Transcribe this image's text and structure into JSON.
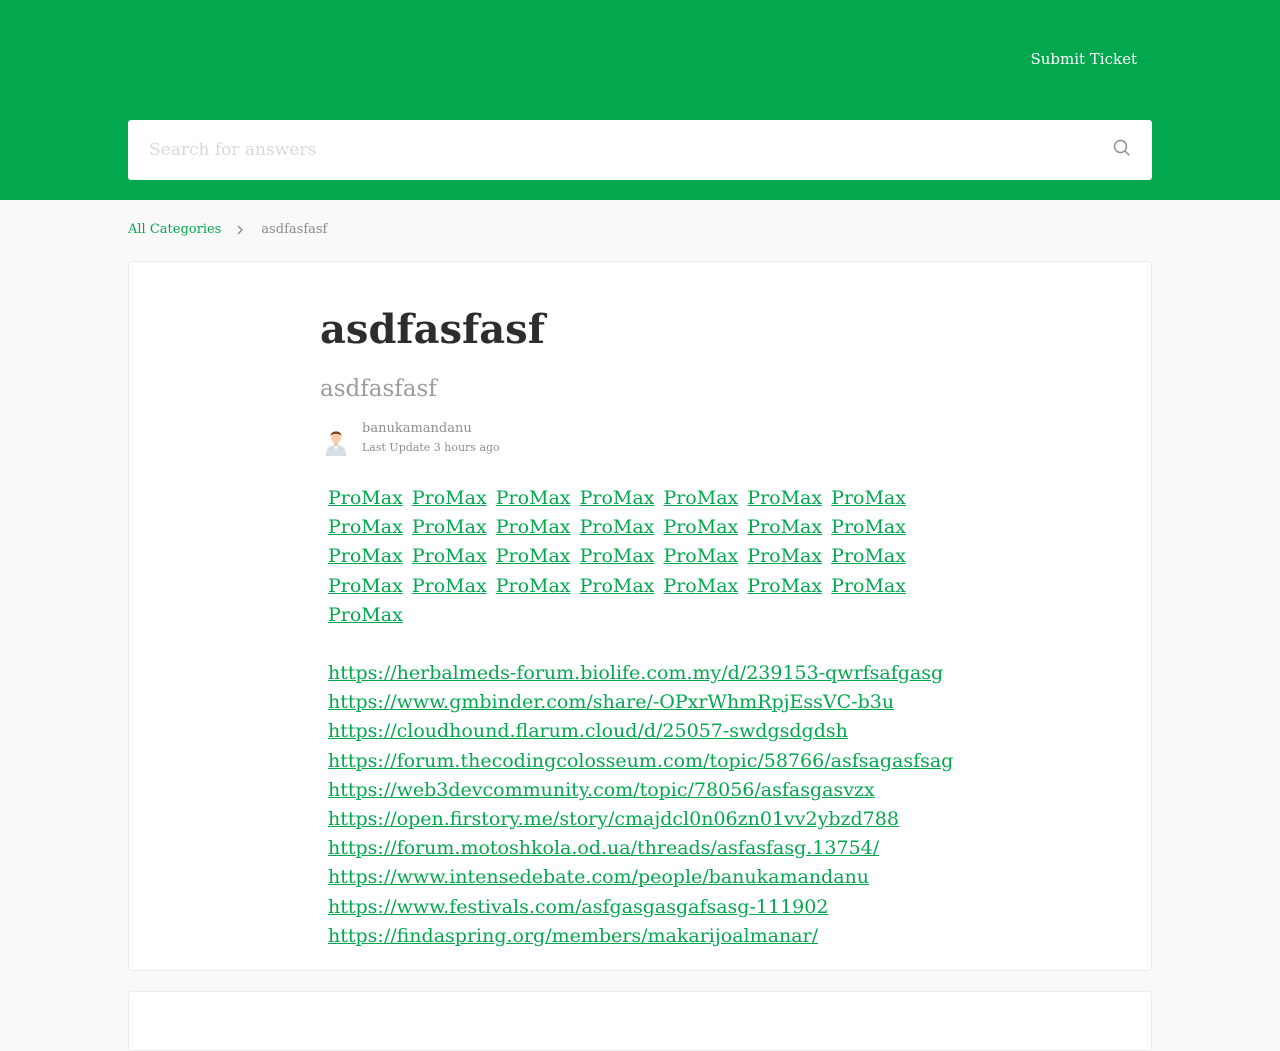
{
  "header": {
    "submit_ticket": "Submit Ticket",
    "bg_color": "#03a84e"
  },
  "search": {
    "placeholder": "Search for answers",
    "value": "",
    "icon": "search-icon"
  },
  "breadcrumb": {
    "root": "All Categories",
    "separator_icon": "chevron-right-icon",
    "current": "asdfasfasf"
  },
  "article": {
    "title": "asdfasfasf",
    "subtitle": "asdfasfasf",
    "author": {
      "avatar_icon": "user-avatar-icon",
      "name": "banukamandanu",
      "updated": "Last Update 3 hours ago"
    },
    "promax_links": [
      "ProMax",
      "ProMax",
      "ProMax",
      "ProMax",
      "ProMax",
      "ProMax",
      "ProMax",
      "ProMax",
      "ProMax",
      "ProMax",
      "ProMax",
      "ProMax",
      "ProMax",
      "ProMax",
      "ProMax",
      "ProMax",
      "ProMax",
      "ProMax",
      "ProMax",
      "ProMax",
      "ProMax",
      "ProMax",
      "ProMax",
      "ProMax",
      "ProMax",
      "ProMax",
      "ProMax",
      "ProMax",
      "ProMax"
    ],
    "url_links": [
      "https://herbalmeds-forum.biolife.com.my/d/239153-qwrfsafgasg",
      "https://www.gmbinder.com/share/-OPxrWhmRpjEssVC-b3u",
      "https://cloudhound.flarum.cloud/d/25057-swdgsdgdsh",
      "https://forum.thecodingcolosseum.com/topic/58766/asfsagasfsag",
      "https://web3devcommunity.com/topic/78056/asfasgasvzx",
      "https://open.firstory.me/story/cmajdcl0n06zn01vv2ybzd788",
      "https://forum.motoshkola.od.ua/threads/asfasfasg.13754/",
      "https://www.intensedebate.com/people/banukamandanu",
      "https://www.festivals.com/asfgasgasgafsasg-111902",
      "https://findaspring.org/members/makarijoalmanar/"
    ],
    "link_color": "#03a84e"
  }
}
